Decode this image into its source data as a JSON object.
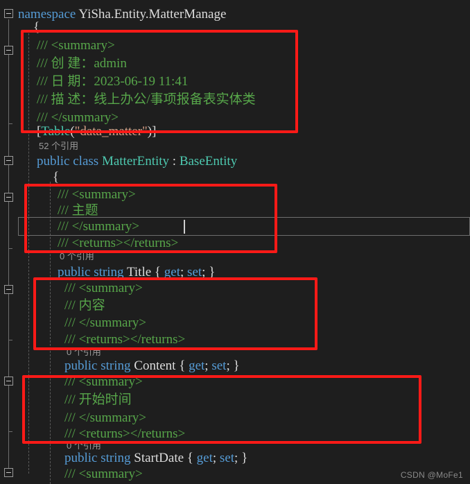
{
  "editor": {
    "background_color": "#1e1e1e",
    "watermark": "CSDN @MoFe1"
  },
  "colors": {
    "keyword": "#569cd6",
    "type": "#4ec9b0",
    "comment": "#57a64a",
    "string": "#d69d85",
    "identifier": "#dcdcdc",
    "annotation_red": "#fc1a17",
    "codelens": "#9a9a9a"
  },
  "code": {
    "namespace_keyword": "namespace",
    "namespace_name": "YiSha.Entity.MatterManage",
    "open_brace": "{",
    "doc_summary_open": "/// <summary>",
    "doc_created_by": "/// 创 建：admin",
    "doc_date": "/// 日 期：2023-06-19 11:41",
    "doc_description": "/// 描 述：线上办公/事项报备表实体类",
    "doc_summary_close": "/// </summary>",
    "attribute_open": "[",
    "attribute_name": "Table",
    "attribute_paren_open": "(",
    "attribute_string": "\"data_matter\"",
    "attribute_paren_close": ")",
    "attribute_close": "]",
    "codelens_class": "52 个引用",
    "codelens_property": "0 个引用",
    "class_public": "public",
    "class_keyword": "class",
    "class_name": "MatterEntity",
    "class_colon": " : ",
    "class_base": "BaseEntity",
    "class_open_brace": "{",
    "doc_title_summary": "/// 主题",
    "doc_content_summary": "/// 内容",
    "doc_startdate_summary": "/// 开始时间",
    "doc_returns": "/// <returns></returns>",
    "prop_public": "public",
    "prop_type": "string",
    "prop_title": "Title",
    "prop_content": "Content",
    "prop_startdate": "StartDate",
    "prop_accessors": "{ get; set; }",
    "accessor_open": "{ ",
    "accessor_get": "get",
    "accessor_semi1": "; ",
    "accessor_set": "set",
    "accessor_semi2": "; ",
    "accessor_close": "}"
  },
  "annotations": {
    "box_class_doc_label": "class-doc-comment-highlight",
    "box_title_doc_label": "title-doc-comment-highlight",
    "box_content_doc_label": "content-doc-comment-highlight",
    "box_startdate_doc_label": "startdate-doc-comment-highlight"
  },
  "gutter": {
    "fold_namespace_label": "fold-namespace",
    "fold_class_label": "fold-class",
    "fold_region_label": "fold-region"
  }
}
